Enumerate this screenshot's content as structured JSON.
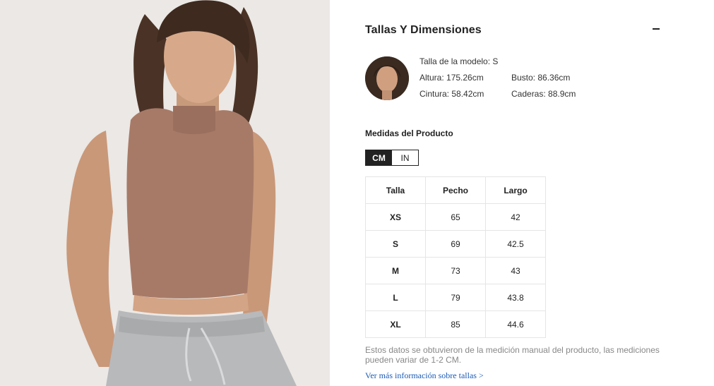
{
  "section": {
    "title": "Tallas Y Dimensiones",
    "collapse_icon": "minus-icon"
  },
  "model": {
    "size_label": "Talla de la modelo: S",
    "height": "Altura: 175.26cm",
    "bust": "Busto: 86.36cm",
    "waist": "Cintura: 58.42cm",
    "hips": "Caderas: 88.9cm"
  },
  "measurements": {
    "title": "Medidas del Producto",
    "units": [
      {
        "label": "CM",
        "active": true
      },
      {
        "label": "IN",
        "active": false
      }
    ],
    "headers": [
      "Talla",
      "Pecho",
      "Largo"
    ],
    "rows": [
      [
        "XS",
        "65",
        "42"
      ],
      [
        "S",
        "69",
        "42.5"
      ],
      [
        "M",
        "73",
        "43"
      ],
      [
        "L",
        "79",
        "43.8"
      ],
      [
        "XL",
        "85",
        "44.6"
      ]
    ]
  },
  "disclaimer": "Estos datos se obtuvieron de la medición manual del producto, las mediciones pueden variar de 1-2 CM.",
  "more_link": "Ver más información sobre tallas >",
  "colors": {
    "top_fabric": "#a77a68",
    "pants": "#b8b9bb",
    "background": "#ece9e6"
  }
}
